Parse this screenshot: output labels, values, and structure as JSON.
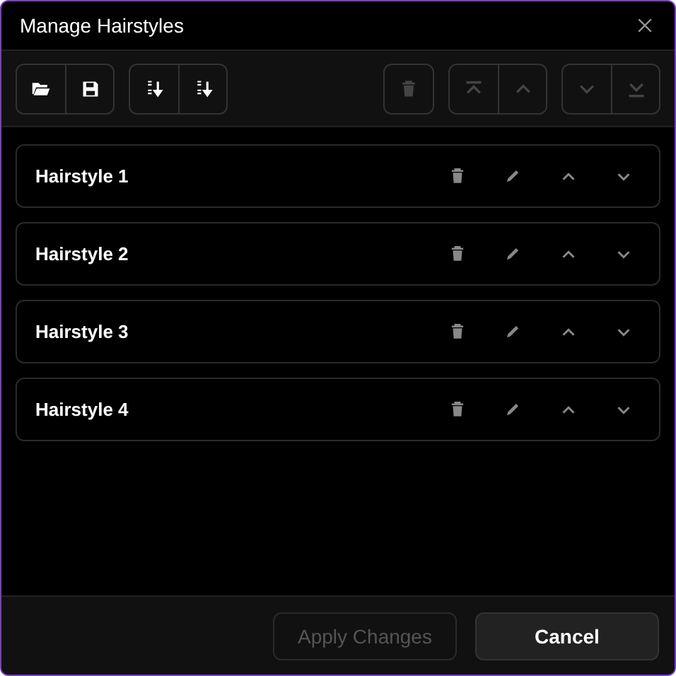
{
  "window": {
    "title": "Manage Hairstyles"
  },
  "toolbar": [
    [
      {
        "kind": "open",
        "disabled": false
      },
      {
        "kind": "save",
        "disabled": false
      }
    ],
    [
      {
        "kind": "sort-asc",
        "disabled": false
      },
      {
        "kind": "sort-desc",
        "disabled": false
      }
    ],
    [
      {
        "kind": "spacer"
      }
    ],
    [
      {
        "kind": "delete",
        "disabled": true
      }
    ],
    [
      {
        "kind": "top",
        "disabled": true
      },
      {
        "kind": "up",
        "disabled": true
      }
    ],
    [
      {
        "kind": "down",
        "disabled": true
      },
      {
        "kind": "bottom",
        "disabled": true
      }
    ]
  ],
  "items": [
    {
      "name": "Hairstyle 1"
    },
    {
      "name": "Hairstyle 2"
    },
    {
      "name": "Hairstyle 3"
    },
    {
      "name": "Hairstyle 4"
    }
  ],
  "footer": [
    {
      "label": "Apply Changes",
      "disabled": true
    },
    {
      "label": "Cancel",
      "disabled": false
    }
  ]
}
